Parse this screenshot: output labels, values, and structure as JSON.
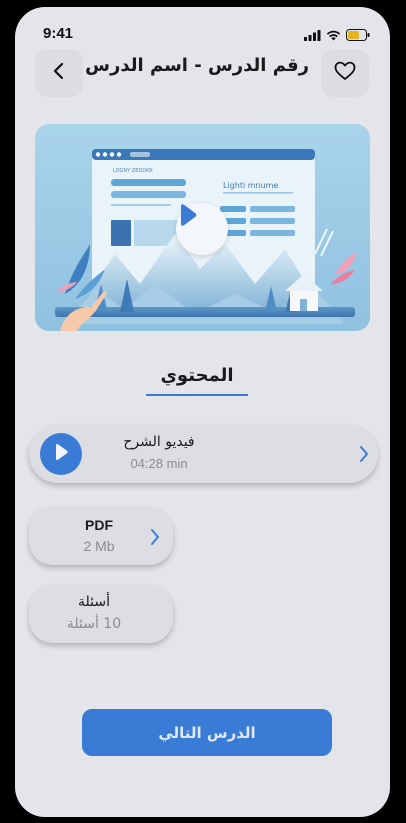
{
  "status_bar": {
    "time": "9:41"
  },
  "header": {
    "title": "رقم الدرس - اسم الدرس",
    "back_icon": "chevron-left-icon",
    "favorite_icon": "heart-icon"
  },
  "video_preview": {
    "thumb_heading": "Lighti mnume",
    "thumb_caption": "LOGNY ZEDDKK",
    "play_icon": "play-icon"
  },
  "content_section": {
    "title": "المحتوي"
  },
  "items": {
    "video": {
      "title": "فيديو الشرح",
      "duration": "04:28 min"
    },
    "pdf": {
      "title": "PDF",
      "size": "2 Mb"
    },
    "quiz": {
      "title": "أسئلة",
      "count": "10 أسئلة"
    }
  },
  "next_button": {
    "label": "الدرس التالي"
  },
  "colors": {
    "accent": "#3a7bd5",
    "background": "#e4e5ea",
    "card": "#dddee3",
    "muted_text": "#8a8b90"
  }
}
